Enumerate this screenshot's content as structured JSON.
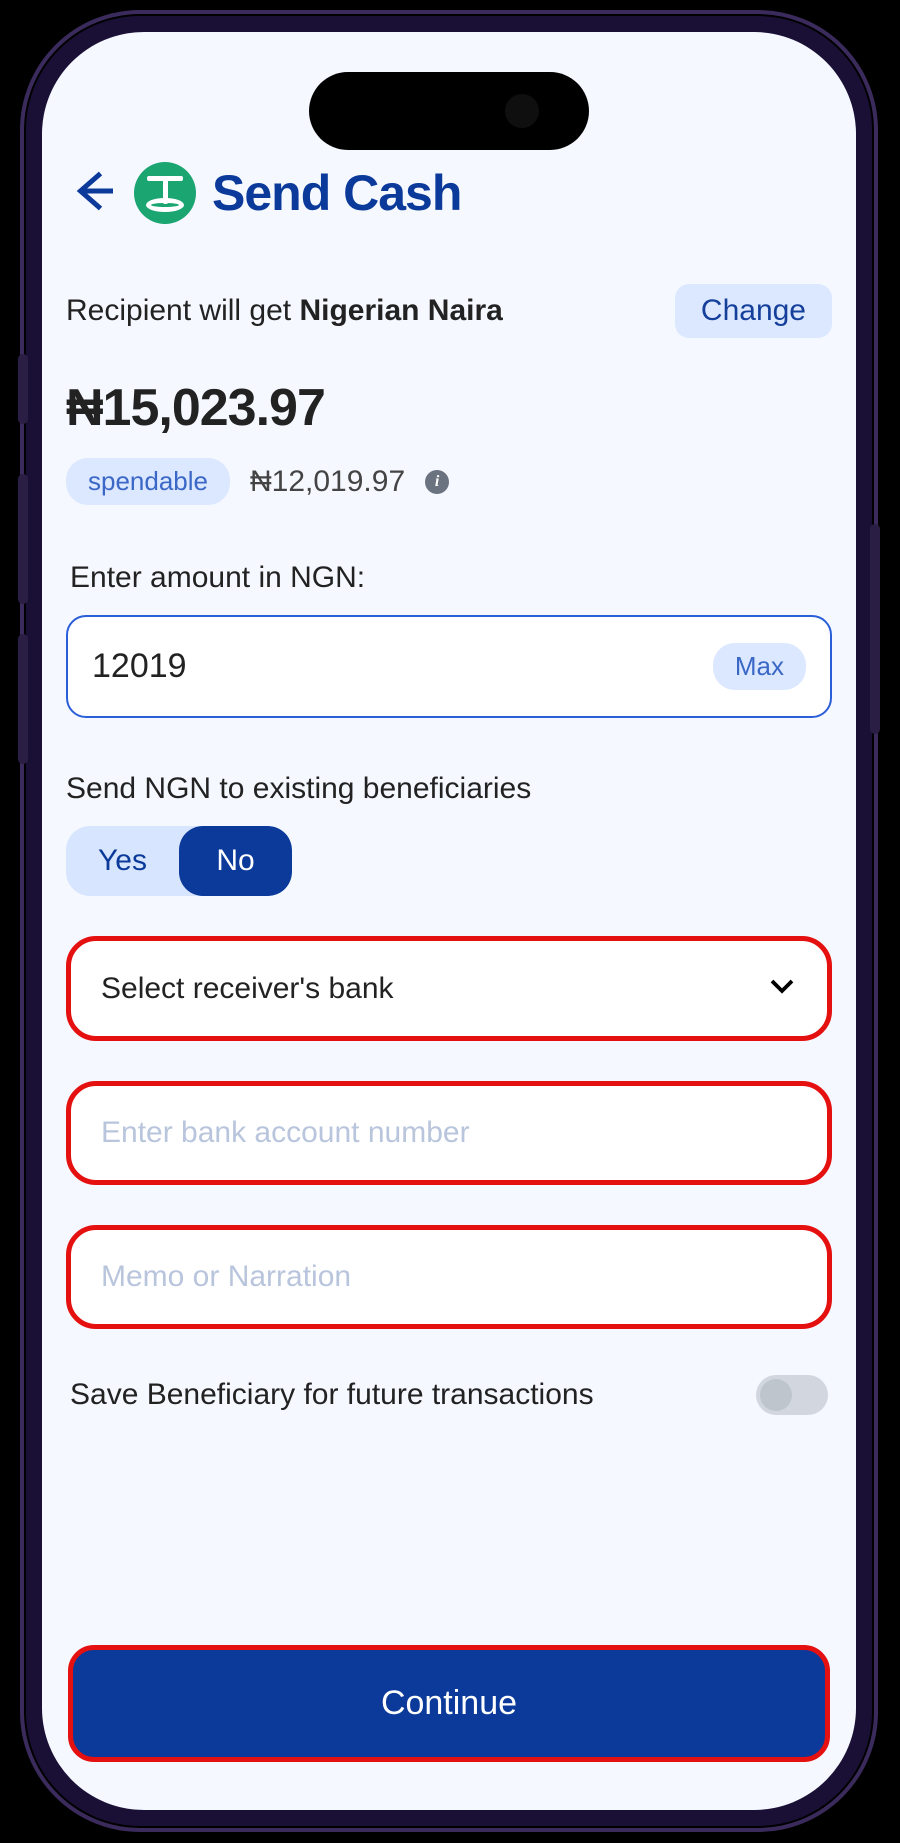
{
  "header": {
    "title": "Send Cash"
  },
  "recipient": {
    "prefix": "Recipient will get ",
    "currency_name": "Nigerian Naira",
    "change_label": "Change"
  },
  "balance": {
    "amount_display": "₦15,023.97",
    "spendable_label": "spendable",
    "spendable_amount": "₦12,019.97"
  },
  "amount": {
    "label": "Enter amount in NGN:",
    "value": "12019",
    "max_label": "Max"
  },
  "beneficiary": {
    "label": "Send NGN to existing beneficiaries",
    "yes_label": "Yes",
    "no_label": "No",
    "selected": "No"
  },
  "fields": {
    "bank_select": "Select receiver's bank",
    "account_placeholder": "Enter bank account number",
    "memo_placeholder": "Memo or Narration"
  },
  "save_row": {
    "label": "Save Beneficiary for future transactions",
    "value": false
  },
  "cta": {
    "continue": "Continue"
  },
  "colors": {
    "primary": "#0b3a9a",
    "error_border": "#e51010",
    "pill_bg": "#dbe8ff",
    "tether": "#1aa571"
  }
}
